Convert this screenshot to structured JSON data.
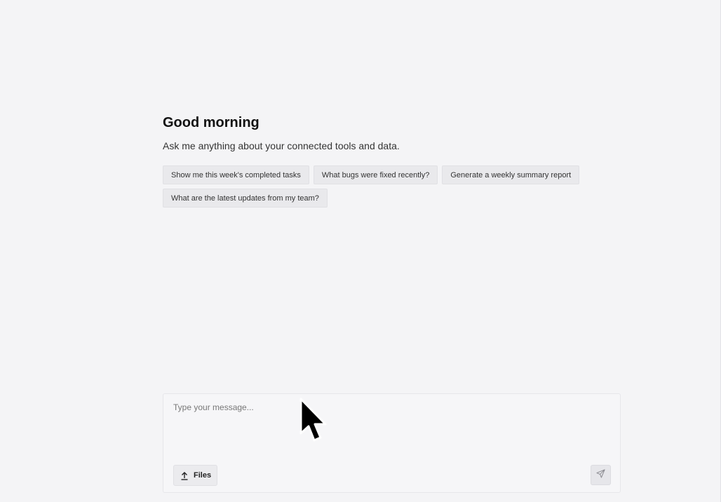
{
  "greeting": {
    "title": "Good morning",
    "subtitle": "Ask me anything about your connected tools and data."
  },
  "suggestions": [
    {
      "label": "Show me this week's completed tasks"
    },
    {
      "label": "What bugs were fixed recently?"
    },
    {
      "label": "Generate a weekly summary report"
    },
    {
      "label": "What are the latest updates from my team?"
    }
  ],
  "composer": {
    "placeholder": "Type your message...",
    "value": "",
    "files_label": "Files",
    "files_icon": "upload-icon",
    "send_icon": "send-icon"
  },
  "colors": {
    "background": "#f4f4f6",
    "chip_background": "#e9e9ec",
    "text": "#1a1a1a"
  }
}
